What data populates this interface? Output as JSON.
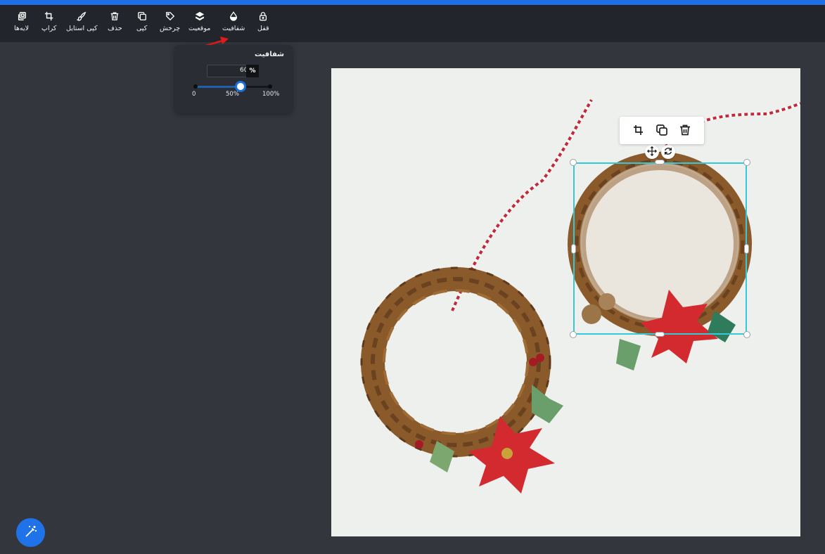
{
  "toolbar": {
    "items": [
      {
        "label": "لایه‌ها",
        "icon": "layers-icon"
      },
      {
        "label": "کراپ",
        "icon": "crop-icon"
      },
      {
        "label": "کپی استایل",
        "icon": "brush-icon"
      },
      {
        "label": "حذف",
        "icon": "trash-icon"
      },
      {
        "label": "کپی",
        "icon": "copy-icon"
      },
      {
        "label": "چرخش",
        "icon": "rotate-tag-icon"
      },
      {
        "label": "موقعیت",
        "icon": "stack-icon"
      },
      {
        "label": "شفافیت",
        "icon": "drop-icon"
      },
      {
        "label": "قفل",
        "icon": "lock-icon"
      }
    ]
  },
  "opacity_panel": {
    "title": "شفافیت",
    "value": "60",
    "unit": "%",
    "slider_value": 60,
    "ticks": [
      "0",
      "50%",
      "100%"
    ]
  },
  "selection_toolbar": {
    "icons": [
      "crop-icon",
      "copy-icon",
      "trash-icon"
    ]
  },
  "selection_controls": {
    "icons": [
      "move-icon",
      "rotate-icon"
    ]
  },
  "magic_button": {
    "icon": "magic-wand-icon"
  },
  "colors": {
    "accent": "#1f6fe5",
    "toolbar_bg": "#22252b",
    "workspace_bg": "#33373d",
    "selection": "#35c8d6"
  }
}
